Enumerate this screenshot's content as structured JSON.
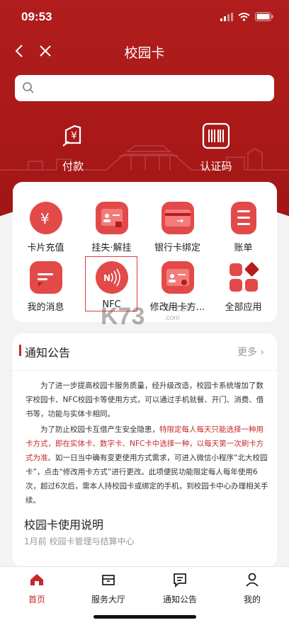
{
  "status": {
    "time": "09:53"
  },
  "nav": {
    "title": "校园卡"
  },
  "search": {
    "placeholder": ""
  },
  "quick_actions": [
    {
      "label": "付款",
      "icon": "payment-icon"
    },
    {
      "label": "认证码",
      "icon": "barcode-icon"
    }
  ],
  "services": [
    {
      "label": "卡片充值",
      "icon": "yen-coin-icon"
    },
    {
      "label": "挂失·解挂",
      "icon": "id-card-lock-icon"
    },
    {
      "label": "银行卡绑定",
      "icon": "bank-card-icon"
    },
    {
      "label": "账单",
      "icon": "bill-list-icon"
    },
    {
      "label": "我的消息",
      "icon": "message-icon"
    },
    {
      "label": "NFC",
      "icon": "nfc-icon"
    },
    {
      "label": "修改用卡方...",
      "icon": "id-card-settings-icon"
    },
    {
      "label": "全部应用",
      "icon": "all-apps-icon"
    }
  ],
  "notice": {
    "title": "通知公告",
    "more": "更多",
    "p1": "为了进一步提高校园卡服务质量，经升级改造，校园卡系统增加了数字校园卡、NFC校园卡等使用方式，可以通过手机就餐、开门、消费、借书等，功能与实体卡相同。",
    "p2_a": "为了防止校园卡互借产生安全隐患，",
    "p2_red": "特限定每人每天只能选择一种用卡方式，即在实体卡、数字卡、NFC卡中选择一种，以每天第一次刷卡方式为准。",
    "p2_b": "如一日当中确有变更使用方式需求，可进入微信小程序“北大校园卡”，点击“修改用卡方式”进行更改。此项便民功能限定每人每年使用6次，超过6次后，需本人持校园卡或绑定的手机，到校园卡中心办理相关手续。"
  },
  "article": {
    "title": "校园卡使用说明",
    "meta": "1月前  校园卡管理与结算中心"
  },
  "tabs": [
    {
      "label": "首页",
      "icon": "home-icon"
    },
    {
      "label": "服务大厅",
      "icon": "service-hall-icon"
    },
    {
      "label": "通知公告",
      "icon": "notice-icon"
    },
    {
      "label": "我的",
      "icon": "profile-icon"
    }
  ],
  "watermark": {
    "text": "K73",
    "sub": "游戏之家 .com"
  },
  "colors": {
    "brand": "#b11d1d",
    "accent": "#e24a4a",
    "text_red": "#c62828"
  }
}
